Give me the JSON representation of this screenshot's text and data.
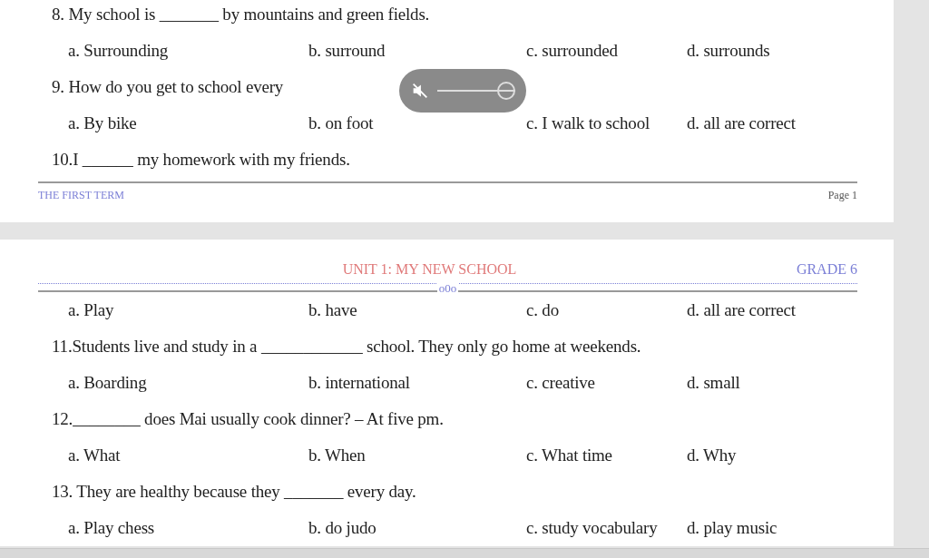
{
  "pages": [
    {
      "items": [
        {
          "kind": "question",
          "text": "8. My school is _______ by mountains and green fields."
        },
        {
          "kind": "options",
          "options": [
            "a. Surrounding",
            "b. surround",
            "c. surrounded",
            "d. surrounds"
          ]
        },
        {
          "kind": "question",
          "text": "9. How do you get to school every"
        },
        {
          "kind": "options",
          "options": [
            "a. By bike",
            "b. on foot",
            "c. I walk to school",
            "d. all are correct"
          ]
        },
        {
          "kind": "question",
          "text": "10.I ______ my homework with my friends."
        }
      ],
      "footer": {
        "left": "THE FIRST TERM",
        "right": "Page 1"
      }
    },
    {
      "header": {
        "title": "UNIT 1: MY NEW SCHOOL",
        "grade": "GRADE 6",
        "ornament": "o0o"
      },
      "items": [
        {
          "kind": "options",
          "options": [
            "a. Play",
            "b. have",
            "c. do",
            "d. all are correct"
          ]
        },
        {
          "kind": "question",
          "text": "11.Students live and study in a ____________ school. They only go home at weekends."
        },
        {
          "kind": "options",
          "options": [
            "a. Boarding",
            "b. international",
            "c. creative",
            "d. small"
          ]
        },
        {
          "kind": "question",
          "text": "12.________ does Mai usually cook dinner? – At five pm."
        },
        {
          "kind": "options",
          "options": [
            "a. What",
            "b. When",
            "c. What time",
            "d. Why"
          ]
        },
        {
          "kind": "question",
          "text": "13. They are healthy because they _______ every day."
        },
        {
          "kind": "options",
          "options": [
            "a. Play chess",
            "b. do judo",
            "c. study vocabulary",
            "d. play music"
          ]
        }
      ]
    }
  ],
  "volume_overlay": {
    "muted": true,
    "level": 1
  }
}
